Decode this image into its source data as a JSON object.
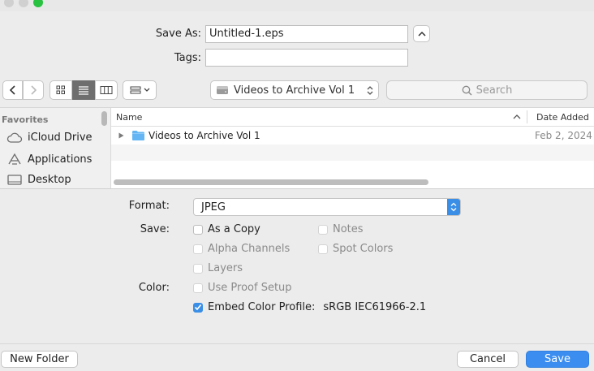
{
  "window": {
    "traffic_lights": [
      {
        "name": "close",
        "color": "#d0d0d0"
      },
      {
        "name": "minimize",
        "color": "#d0d0d0"
      },
      {
        "name": "zoom",
        "color": "#29c240"
      }
    ]
  },
  "save_as": {
    "label": "Save As:",
    "value": "Untitled-1.eps"
  },
  "tags": {
    "label": "Tags:",
    "value": ""
  },
  "toolbar": {
    "location": "Videos to Archive Vol 1",
    "search_placeholder": "Search"
  },
  "sidebar": {
    "section_title": "Favorites",
    "items": [
      {
        "label": "iCloud Drive",
        "icon": "cloud-icon"
      },
      {
        "label": "Applications",
        "icon": "applications-icon"
      },
      {
        "label": "Desktop",
        "icon": "desktop-icon"
      }
    ]
  },
  "file_list": {
    "columns": {
      "name": "Name",
      "date": "Date Added"
    },
    "rows": [
      {
        "name": "Videos to Archive Vol 1",
        "date": "Feb 2, 2024",
        "icon": "folder-icon"
      }
    ]
  },
  "options": {
    "format_label": "Format:",
    "format_value": "JPEG",
    "save_label": "Save:",
    "color_label": "Color:",
    "as_a_copy": "As a Copy",
    "notes": "Notes",
    "alpha_channels": "Alpha Channels",
    "spot_colors": "Spot Colors",
    "layers": "Layers",
    "use_proof_setup": "Use Proof Setup",
    "embed_color_profile": "Embed Color Profile:",
    "color_profile_value": "sRGB IEC61966-2.1"
  },
  "footer": {
    "new_folder": "New Folder",
    "cancel": "Cancel",
    "save": "Save"
  },
  "colors": {
    "accent": "#3a8ee6",
    "save_button": "#3b8ef0"
  }
}
